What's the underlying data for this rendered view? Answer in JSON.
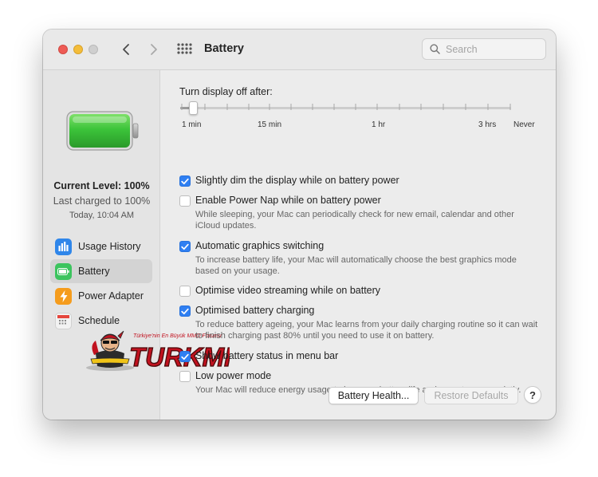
{
  "window": {
    "title": "Battery"
  },
  "search": {
    "placeholder": "Search"
  },
  "status": {
    "current_level": "Current Level: 100%",
    "last_charged": "Last charged to 100%",
    "timestamp": "Today, 10:04 AM",
    "battery_level_fraction": 1.0
  },
  "sidebar": {
    "items": [
      {
        "label": "Usage History",
        "icon": "usage-history-icon",
        "active": false
      },
      {
        "label": "Battery",
        "icon": "battery-icon",
        "active": true
      },
      {
        "label": "Power Adapter",
        "icon": "power-adapter-icon",
        "active": false
      },
      {
        "label": "Schedule",
        "icon": "calendar-icon",
        "active": false
      }
    ]
  },
  "display_off": {
    "label": "Turn display off after:",
    "ticks": [
      "1 min",
      "15 min",
      "1 hr",
      "3 hrs",
      "Never"
    ],
    "selected": "1 min"
  },
  "options": [
    {
      "label": "Slightly dim the display while on battery power",
      "checked": true,
      "description": ""
    },
    {
      "label": "Enable Power Nap while on battery power",
      "checked": false,
      "description": "While sleeping, your Mac can periodically check for new email, calendar and other iCloud updates."
    },
    {
      "label": "Automatic graphics switching",
      "checked": true,
      "description": "To increase battery life, your Mac will automatically choose the best graphics mode based on your usage."
    },
    {
      "label": "Optimise video streaming while on battery",
      "checked": false,
      "description": ""
    },
    {
      "label": "Optimised battery charging",
      "checked": true,
      "description": "To reduce battery ageing, your Mac learns from your daily charging routine so it can wait to finish charging past 80% until you need to use it on battery."
    },
    {
      "label": "Show battery status in menu bar",
      "checked": true,
      "description": ""
    },
    {
      "label": "Low power mode",
      "checked": false,
      "description": "Your Mac will reduce energy usage to increase battery life and operate more quietly."
    }
  ],
  "buttons": {
    "battery_health": "Battery Health...",
    "restore_defaults": "Restore Defaults",
    "help": "?"
  },
  "watermark": {
    "text": "TURKMMO",
    "tagline": "Türkiye'nin En Büyük MMO Forumu"
  },
  "colors": {
    "accent": "#2f7ff2",
    "battery_green": "#3cc43a",
    "close": "#ee5b55",
    "minimize": "#f4bd3a"
  }
}
